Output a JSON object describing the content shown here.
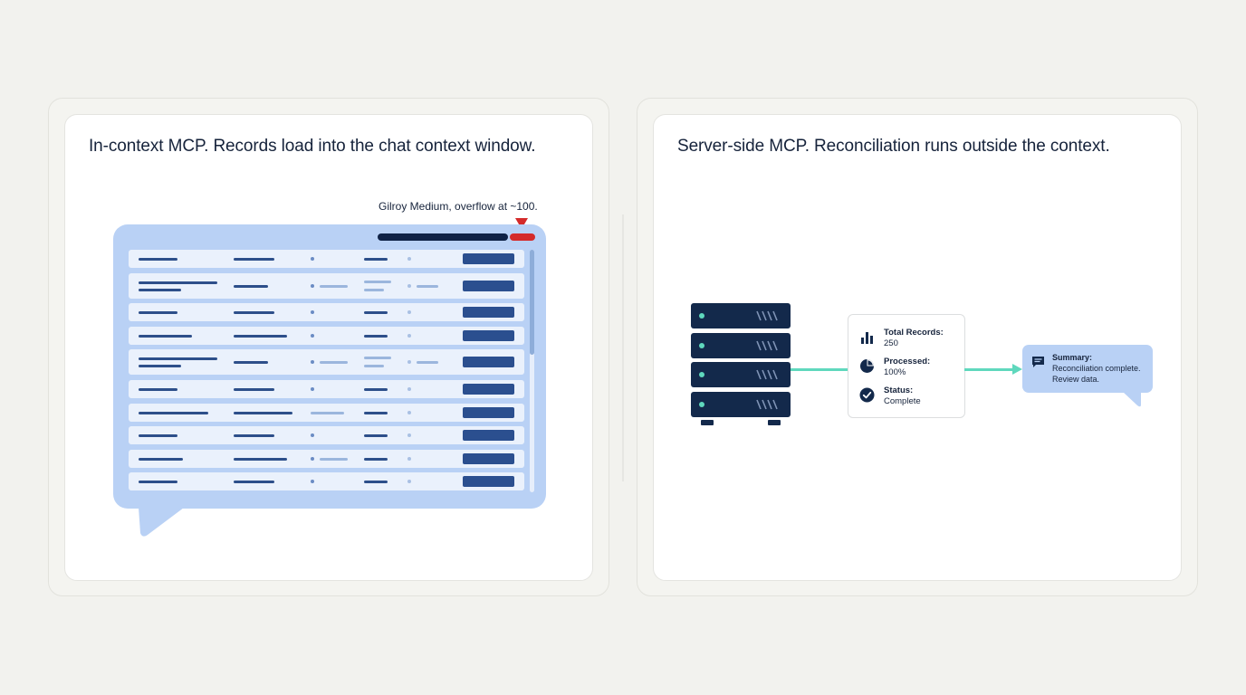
{
  "left_panel": {
    "title": "In-context MCP. Records load into the chat context window.",
    "overflow_note": "Gilroy Medium, overflow at ~100.",
    "row_count": 10,
    "colors": {
      "bubble": "#b9d1f5",
      "overflow": "#d42a2a",
      "bar": "#0f2246"
    }
  },
  "right_panel": {
    "title": "Server-side MCP. Reconciliation runs outside the context.",
    "server_icon": "server-rack-icon",
    "stats": [
      {
        "label": "Total Records:",
        "value": "250",
        "icon": "bar-chart-icon"
      },
      {
        "label": "Processed:",
        "value": "100%",
        "icon": "pie-chart-icon"
      },
      {
        "label": "Status:",
        "value": "Complete",
        "icon": "check-circle-icon"
      }
    ],
    "summary": {
      "icon": "chat-message-icon",
      "title": "Summary:",
      "line1": "Reconciliation complete.",
      "line2": "Review data."
    },
    "colors": {
      "server": "#13294b",
      "connector": "#5fd8bd",
      "bubble": "#b9d1f5"
    }
  }
}
